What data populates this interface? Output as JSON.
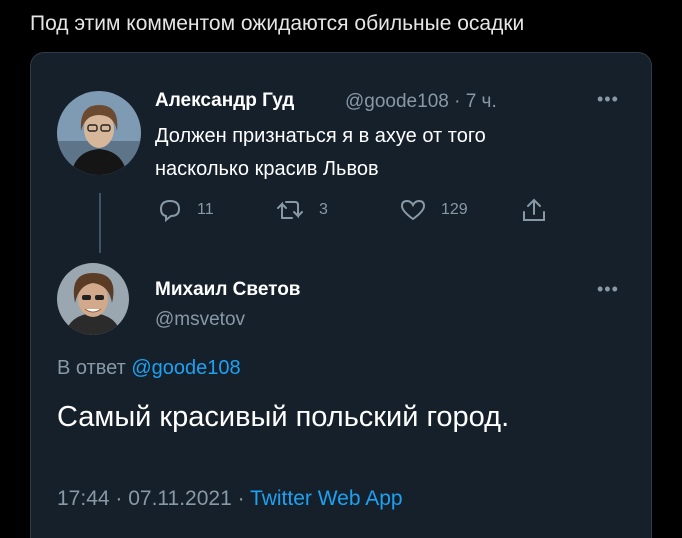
{
  "caption": "Под этим комментом ожидаются обильные осадки",
  "colors": {
    "background": "#000000",
    "card": "#15202b",
    "muted": "#8899a6",
    "accent": "#1da1f2"
  },
  "parent_tweet": {
    "author_name": "Александр Гуд",
    "handle_time": "@goode108 · 7 ч.",
    "text_line1": "Должен признаться я в ахуе от того",
    "text_line2": "насколько красив Львов",
    "more_icon": "ellipsis-icon",
    "actions": {
      "reply_count": "11",
      "retweet_count": "3",
      "like_count": "129"
    }
  },
  "reply_tweet": {
    "author_name": "Михаил Светов",
    "handle": "@msvetov",
    "more_icon": "ellipsis-icon",
    "reply_to_prefix": "В ответ",
    "reply_to_mention": "@goode108",
    "text": "Самый красивый польский город.",
    "timestamp": "17:44 · 07.11.2021 · ",
    "source": "Twitter Web App"
  }
}
